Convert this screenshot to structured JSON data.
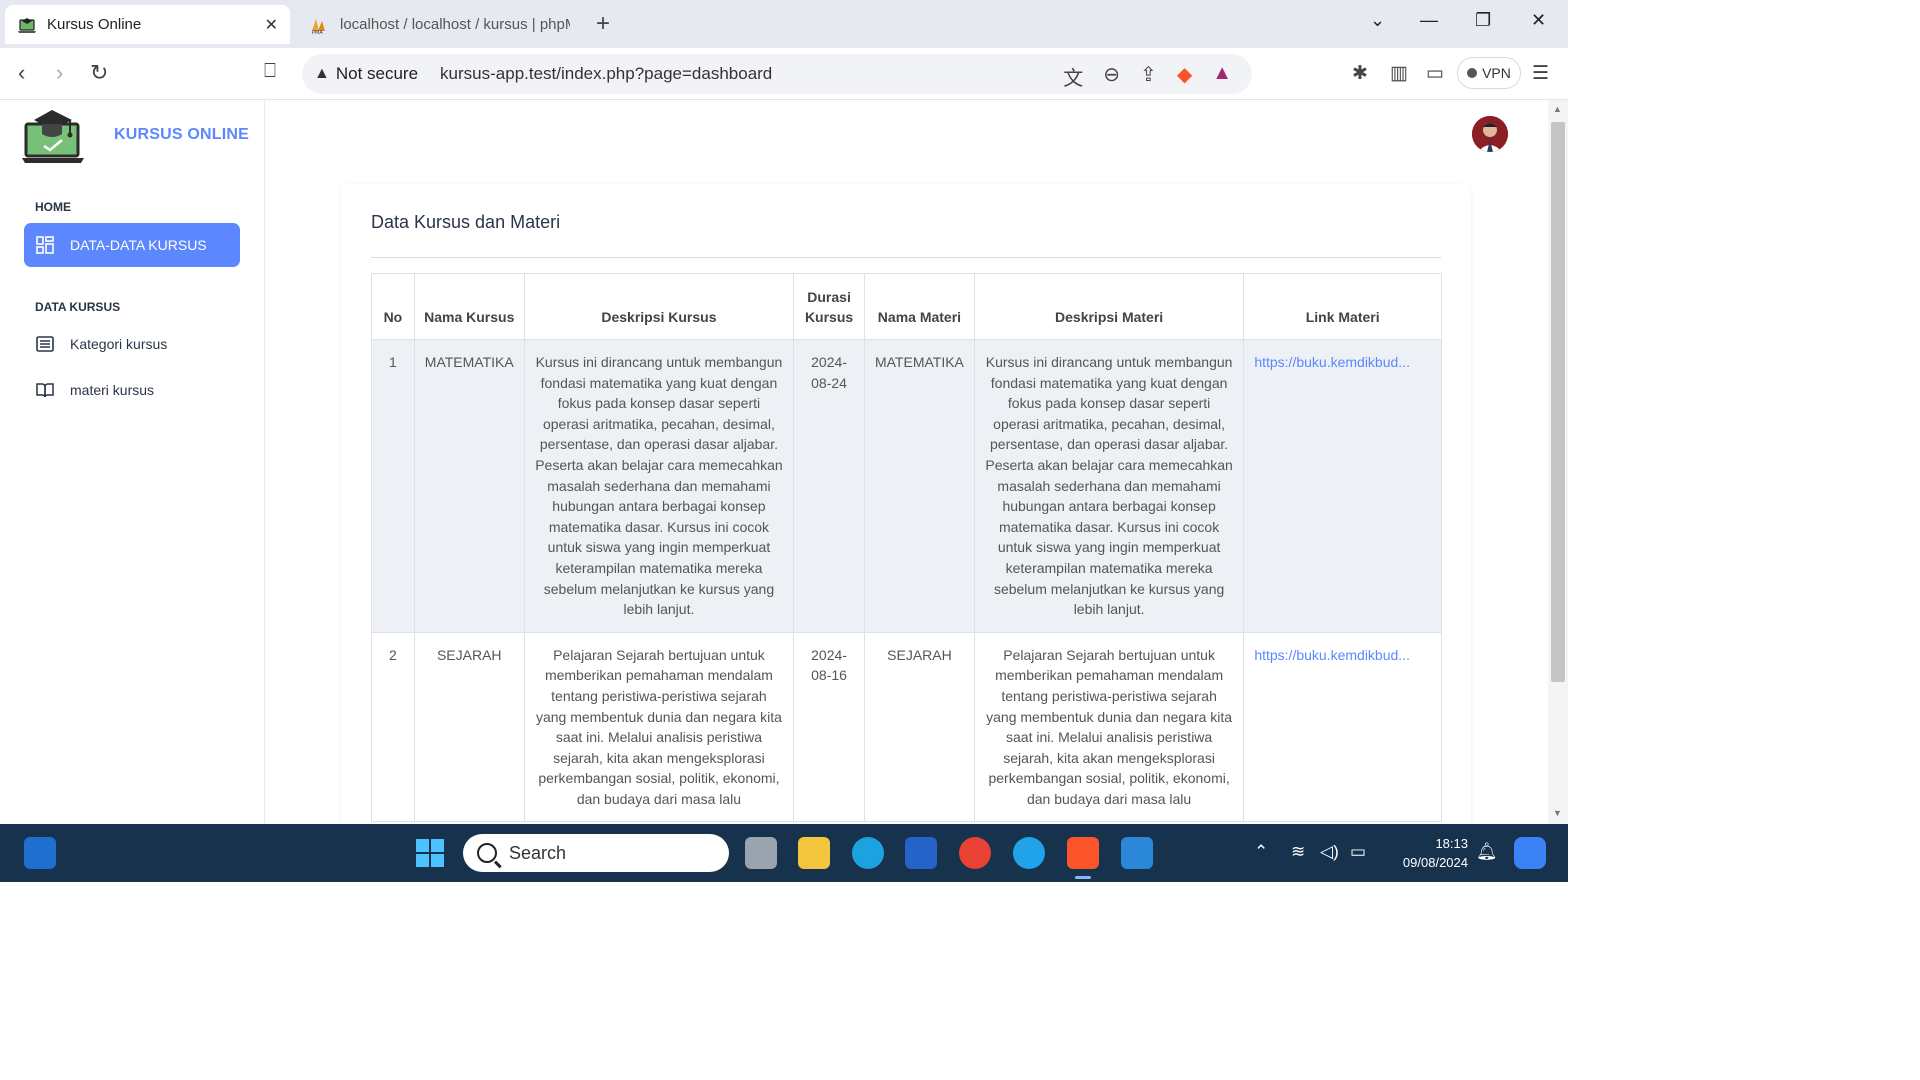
{
  "browser": {
    "tabs": [
      {
        "title": "Kursus Online",
        "active": true
      },
      {
        "title": "localhost / localhost / kursus | phpMyAdmin",
        "active": false
      }
    ],
    "security_label": "Not secure",
    "url": "kursus-app.test/index.php?page=dashboard",
    "vpn_label": "VPN"
  },
  "sidebar": {
    "brand": "KURSUS ONLINE",
    "sections": [
      {
        "title": "HOME",
        "items": [
          {
            "label": "DATA-DATA KURSUS",
            "icon": "dashboard-grid-icon",
            "active": true
          }
        ]
      },
      {
        "title": "DATA KURSUS",
        "items": [
          {
            "label": "Kategori kursus",
            "icon": "list-icon",
            "active": false
          },
          {
            "label": "materi kursus",
            "icon": "book-icon",
            "active": false
          }
        ]
      }
    ]
  },
  "main": {
    "title": "Data Kursus dan Materi",
    "table": {
      "headers": [
        "No",
        "Nama Kursus",
        "Deskripsi Kursus",
        "Durasi Kursus",
        "Nama Materi",
        "Deskripsi Materi",
        "Link Materi"
      ],
      "rows": [
        {
          "no": "1",
          "nama_kursus": "MATEMATIKA",
          "deskripsi_kursus": "Kursus ini dirancang untuk membangun fondasi matematika yang kuat dengan fokus pada konsep dasar seperti operasi aritmatika, pecahan, desimal, persentase, dan operasi dasar aljabar. Peserta akan belajar cara memecahkan masalah sederhana dan memahami hubungan antara berbagai konsep matematika dasar. Kursus ini cocok untuk siswa yang ingin memperkuat keterampilan matematika mereka sebelum melanjutkan ke kursus yang lebih lanjut.",
          "durasi": "2024-08-24",
          "nama_materi": "MATEMATIKA",
          "deskripsi_materi": "Kursus ini dirancang untuk membangun fondasi matematika yang kuat dengan fokus pada konsep dasar seperti operasi aritmatika, pecahan, desimal, persentase, dan operasi dasar aljabar. Peserta akan belajar cara memecahkan masalah sederhana dan memahami hubungan antara berbagai konsep matematika dasar. Kursus ini cocok untuk siswa yang ingin memperkuat keterampilan matematika mereka sebelum melanjutkan ke kursus yang lebih lanjut.",
          "link": "https://buku.kemdikbud..."
        },
        {
          "no": "2",
          "nama_kursus": "SEJARAH",
          "deskripsi_kursus": "Pelajaran Sejarah bertujuan untuk memberikan pemahaman mendalam tentang peristiwa-peristiwa sejarah yang membentuk dunia dan negara kita saat ini. Melalui analisis peristiwa sejarah, kita akan mengeksplorasi perkembangan sosial, politik, ekonomi, dan budaya dari masa lalu",
          "durasi": "2024-08-16",
          "nama_materi": "SEJARAH",
          "deskripsi_materi": "Pelajaran Sejarah bertujuan untuk memberikan pemahaman mendalam tentang peristiwa-peristiwa sejarah yang membentuk dunia dan negara kita saat ini. Melalui analisis peristiwa sejarah, kita akan mengeksplorasi perkembangan sosial, politik, ekonomi, dan budaya dari masa lalu",
          "link": "https://buku.kemdikbud..."
        }
      ]
    }
  },
  "taskbar": {
    "search_placeholder": "Search",
    "time": "18:13",
    "date": "09/08/2024"
  },
  "colors": {
    "accent": "#5d87ff",
    "taskbar": "#17324d",
    "row_stripe": "#edf0f4"
  }
}
